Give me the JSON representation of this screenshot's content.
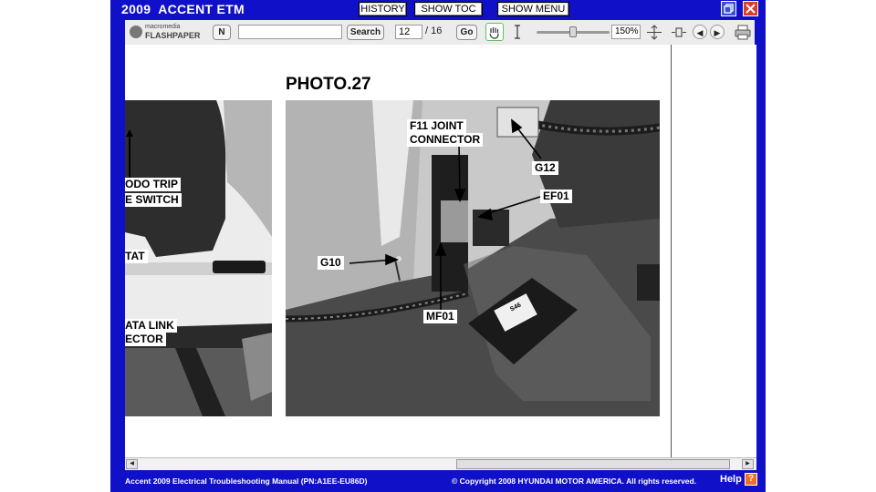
{
  "app": {
    "title": "2009  ACCENT ETM",
    "history_label": "HISTORY",
    "show_toc_label": "SHOW TOC",
    "show_menu_label": "SHOW MENU"
  },
  "toolbar": {
    "brand_top": "macromedia",
    "brand_bottom": "FLASHPAPER",
    "n_button": "N",
    "search_placeholder": "",
    "search_button": "Search",
    "page_current": "12",
    "page_total": "/ 16",
    "go_button": "Go",
    "zoom": "150%"
  },
  "document": {
    "photo_title": "PHOTO.27",
    "left_labels": [
      "ODO TRIP",
      "E SWITCH",
      "TAT",
      "ATA LINK",
      "ECTOR"
    ],
    "callouts": [
      "F11 JOINT",
      "CONNECTOR",
      "G12",
      "EF01",
      "G10",
      "MF01"
    ],
    "sticker_text": "S46"
  },
  "footer": {
    "manual": "Accent 2009 Electrical Troubleshooting Manual (PN:A1EE-EU86D)",
    "copyright": "© Copyright 2008 HYUNDAI MOTOR AMERICA. All rights reserved.",
    "help": "Help",
    "help_icon": "?"
  },
  "colors": {
    "frame_blue": "#1010c8",
    "close_red": "#e03a2a",
    "help_orange": "#f07020"
  }
}
